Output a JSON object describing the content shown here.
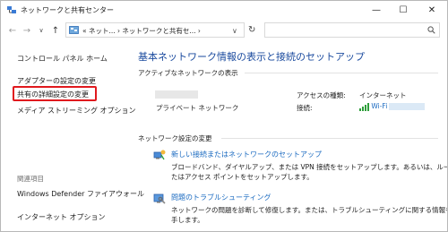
{
  "window": {
    "title": "ネットワークと共有センター",
    "controls": {
      "minimize": "—",
      "maximize": "☐",
      "close": "✕"
    }
  },
  "nav": {
    "back": "←",
    "forward": "→",
    "recent": "∨",
    "up": "↑",
    "breadcrumb": "« ネット... › ネットワークと共有セ... ›",
    "dropdown": "∨",
    "refresh": "↻",
    "search_placeholder": ""
  },
  "sidebar": {
    "home": "コントロール パネル ホーム",
    "links": [
      "アダプターの設定の変更",
      "共有の詳細設定の変更",
      "メディア ストリーミング オプション"
    ],
    "related_header": "関連項目",
    "related": [
      "Windows Defender ファイアウォール",
      "インターネット オプション"
    ]
  },
  "main": {
    "title": "基本ネットワーク情報の表示と接続のセットアップ",
    "active_header": "アクティブなネットワークの表示",
    "network_type": "プライベート ネットワーク",
    "access_type_label": "アクセスの種類:",
    "access_type_value": "インターネット",
    "connection_label": "接続:",
    "connection_value": "Wi-Fi",
    "change_header": "ネットワーク設定の変更",
    "tasks": [
      {
        "link": "新しい接続またはネットワークのセットアップ",
        "desc1": "ブロードバンド、ダイヤルアップ、または VPN 接続をセットアップします。あるいは、ルーターま",
        "desc2": "たはアクセス ポイントをセットアップします。",
        "icon": "network-setup-icon"
      },
      {
        "link": "問題のトラブルシューティング",
        "desc1": "ネットワークの問題を診断して修復します。または、トラブルシューティングに関する情報を入",
        "desc2": "手します。",
        "icon": "troubleshoot-icon"
      }
    ]
  },
  "colors": {
    "link": "#1a6ac0",
    "title": "#1a4a9e",
    "highlight": "#e0191e"
  }
}
